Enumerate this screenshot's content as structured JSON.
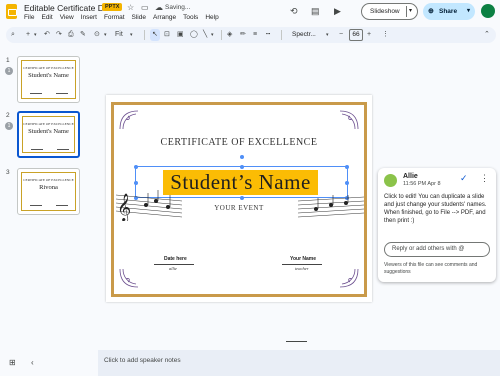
{
  "doc": {
    "title": "Editable Certificate D",
    "badge": "PPTX",
    "star_icon": "☆",
    "folder_icon": "▭",
    "saving": "Saving..."
  },
  "menu": [
    "File",
    "Edit",
    "View",
    "Insert",
    "Format",
    "Slide",
    "Arrange",
    "Tools",
    "Help"
  ],
  "header": {
    "history_icon": "⟲",
    "comment_icon": "▤",
    "meet_icon": "▶",
    "slideshow_label": "Slideshow",
    "share_label": "Share"
  },
  "toolbar": {
    "fit_label": "Fit",
    "font": "Spectr...",
    "font_size": "66"
  },
  "filmstrip": [
    {
      "num": "1",
      "badge": "1",
      "title": "CERTIFICATE OF EXCELLENCE",
      "name": "Student's Name"
    },
    {
      "num": "2",
      "badge": "1",
      "title": "CERTIFICATE OF EXCELLENCE",
      "name": "Student's Name"
    },
    {
      "num": "3",
      "badge": "",
      "title": "CERTIFICATE OF EXCELLENCE",
      "name": "Rivona"
    }
  ],
  "slide": {
    "title": "CERTIFICATE OF EXCELLENCE",
    "name": "Student’s Name",
    "event": "YOUR EVENT",
    "date_label": "Date here",
    "date_sign": "allie",
    "name_label": "Your Name",
    "name_sign": "teacher"
  },
  "comment": {
    "author": "Allie",
    "time": "11:56 PM Apr 8",
    "body_1": "Click to edit! You can duplicate a slide and just change your students' names.",
    "body_2": "When finished, go to File --> PDF, and then print :)",
    "reply_placeholder": "Reply or add others with @",
    "note": "Viewers of this file can see comments and suggestions"
  },
  "notes": {
    "placeholder": "Click to add speaker notes"
  },
  "colors": {
    "accent": "#0b57d0",
    "highlight": "#fbbc04",
    "border_gold": "#c99a4a",
    "share_bg": "#c2e7ff"
  }
}
